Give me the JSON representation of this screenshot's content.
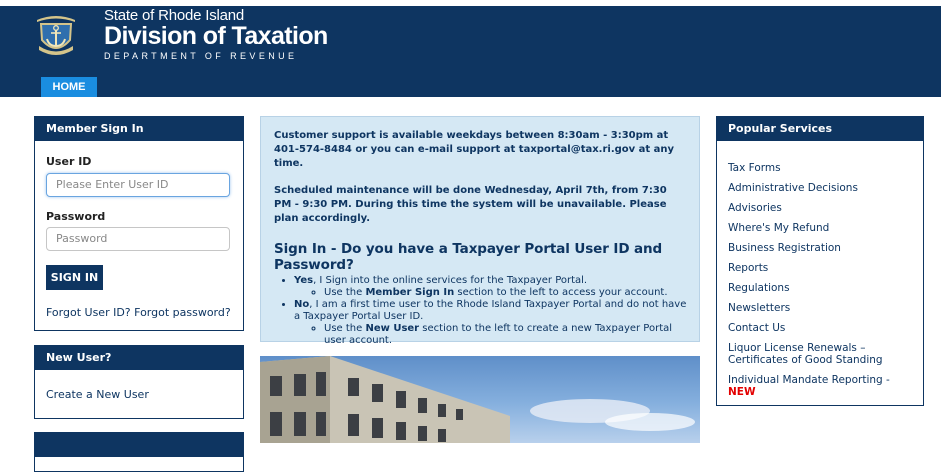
{
  "header": {
    "state_line": "State of Rhode Island",
    "division": "Division of Taxation",
    "department": "DEPARTMENT OF REVENUE",
    "seal_icon": "anchor-seal-icon"
  },
  "nav": {
    "home_label": "HOME"
  },
  "member_signin": {
    "title": "Member Sign In",
    "user_id_label": "User ID",
    "user_id_placeholder": "Please Enter User ID",
    "password_label": "Password",
    "password_placeholder": "Password",
    "signin_button": "SIGN IN",
    "forgot_text": "Forgot User ID? Forgot password?"
  },
  "new_user": {
    "title": "New User?",
    "create_link": "Create a New User"
  },
  "info": {
    "support_text": "Customer support is available weekdays between 8:30am - 3:30pm at 401-574-8484 or you can e-mail support at taxportal@tax.ri.gov at any time.",
    "maintenance_text": "Scheduled maintenance will be done Wednesday, April 7th, from 7:30 PM - 9:30 PM. During this time the system will be unavailable. Please plan accordingly.",
    "signin_heading": "Sign In - Do you have a Taxpayer Portal User ID and Password?",
    "yes_strong": "Yes",
    "yes_text": ", I Sign into the online services for the Taxpayer Portal.",
    "yes_sub_pre": "Use the ",
    "yes_sub_strong": "Member Sign In",
    "yes_sub_post": " section to the left to access your account.",
    "no_strong": "No",
    "no_text": ", I am a first time user to the Rhode Island Taxpayer Portal and do not have a Taxpayer Portal User ID.",
    "no_sub_pre": "Use the ",
    "no_sub_strong": "New User",
    "no_sub_post": " section to the left to create a new Taxpayer Portal user account."
  },
  "popular_services": {
    "title": "Popular Services",
    "items": [
      "Tax Forms",
      "Administrative Decisions",
      "Advisories",
      "Where's My Refund",
      "Business Registration",
      "Reports",
      "Regulations",
      "Newsletters",
      "Contact Us",
      "Liquor License Renewals – Certificates of Good Standing",
      "Individual Mandate Reporting - "
    ],
    "new_tag": "NEW"
  },
  "colors": {
    "navy": "#0e3561",
    "nav_blue": "#1a8de0",
    "info_bg": "#d5e8f4",
    "new_red": "#e30000"
  }
}
